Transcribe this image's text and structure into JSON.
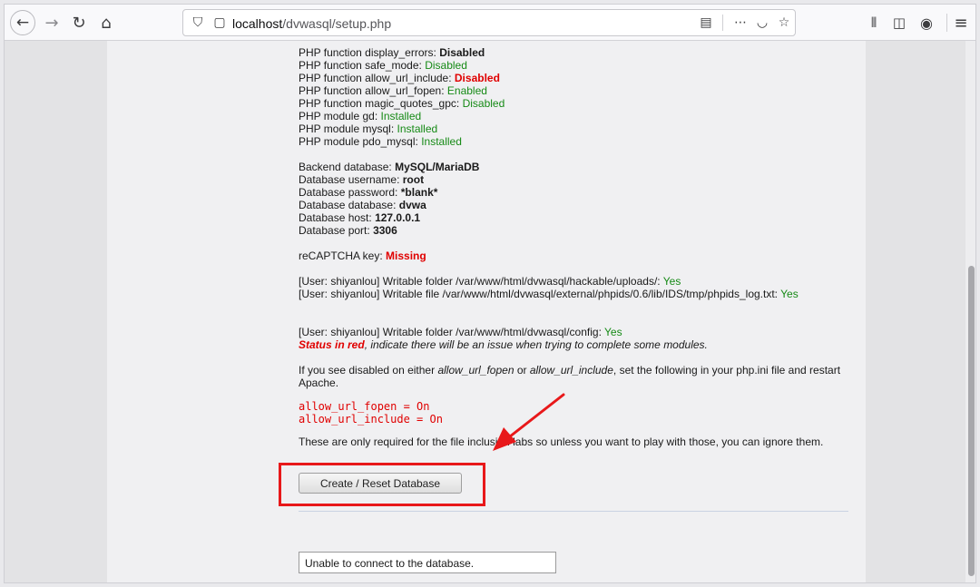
{
  "browser": {
    "url_host": "localhost",
    "url_path": "/dvwasql/setup.php"
  },
  "checks": [
    {
      "label": "PHP function display_errors: ",
      "value": "Disabled",
      "status": "bold"
    },
    {
      "label": "PHP function safe_mode: ",
      "value": "Disabled",
      "status": "ok"
    },
    {
      "label": "PHP function allow_url_include: ",
      "value": "Disabled",
      "status": "bad"
    },
    {
      "label": "PHP function allow_url_fopen: ",
      "value": "Enabled",
      "status": "ok"
    },
    {
      "label": "PHP function magic_quotes_gpc: ",
      "value": "Disabled",
      "status": "ok"
    },
    {
      "label": "PHP module gd: ",
      "value": "Installed",
      "status": "ok"
    },
    {
      "label": "PHP module mysql: ",
      "value": "Installed",
      "status": "ok"
    },
    {
      "label": "PHP module pdo_mysql: ",
      "value": "Installed",
      "status": "ok"
    }
  ],
  "database": [
    {
      "label": "Backend database: ",
      "value": "MySQL/MariaDB"
    },
    {
      "label": "Database username: ",
      "value": "root"
    },
    {
      "label": "Database password: ",
      "value": "*blank*"
    },
    {
      "label": "Database database: ",
      "value": "dvwa"
    },
    {
      "label": "Database host: ",
      "value": "127.0.0.1"
    },
    {
      "label": "Database port: ",
      "value": "3306"
    }
  ],
  "recaptcha": {
    "label": "reCAPTCHA key: ",
    "value": "Missing"
  },
  "writable": [
    {
      "label": "[User: shiyanlou] Writable folder /var/www/html/dvwasql/hackable/uploads/: ",
      "value": "Yes"
    },
    {
      "label": "[User: shiyanlou] Writable file /var/www/html/dvwasql/external/phpids/0.6/lib/IDS/tmp/phpids_log.txt: ",
      "value": "Yes"
    }
  ],
  "config_writable": {
    "label": "[User: shiyanlou] Writable folder /var/www/html/dvwasql/config: ",
    "value": "Yes"
  },
  "status_note": {
    "red": "Status in red",
    "rest": ", indicate there will be an issue when trying to complete some modules."
  },
  "php_ini_note": {
    "p1": "If you see disabled on either ",
    "opt1": "allow_url_fopen",
    "p2": " or ",
    "opt2": "allow_url_include",
    "p3": ", set the following in your php.ini file and restart Apache."
  },
  "code_lines": [
    "allow_url_fopen = On",
    "allow_url_include = On"
  ],
  "required_note": "These are only required for the file inclusion labs so unless you want to play with those, you can ignore them.",
  "button_label": "Create / Reset Database",
  "error_message": "Unable to connect to the database.",
  "colors": {
    "ok": "#168a16",
    "bad": "#e00000",
    "highlight": "#e8181a"
  }
}
